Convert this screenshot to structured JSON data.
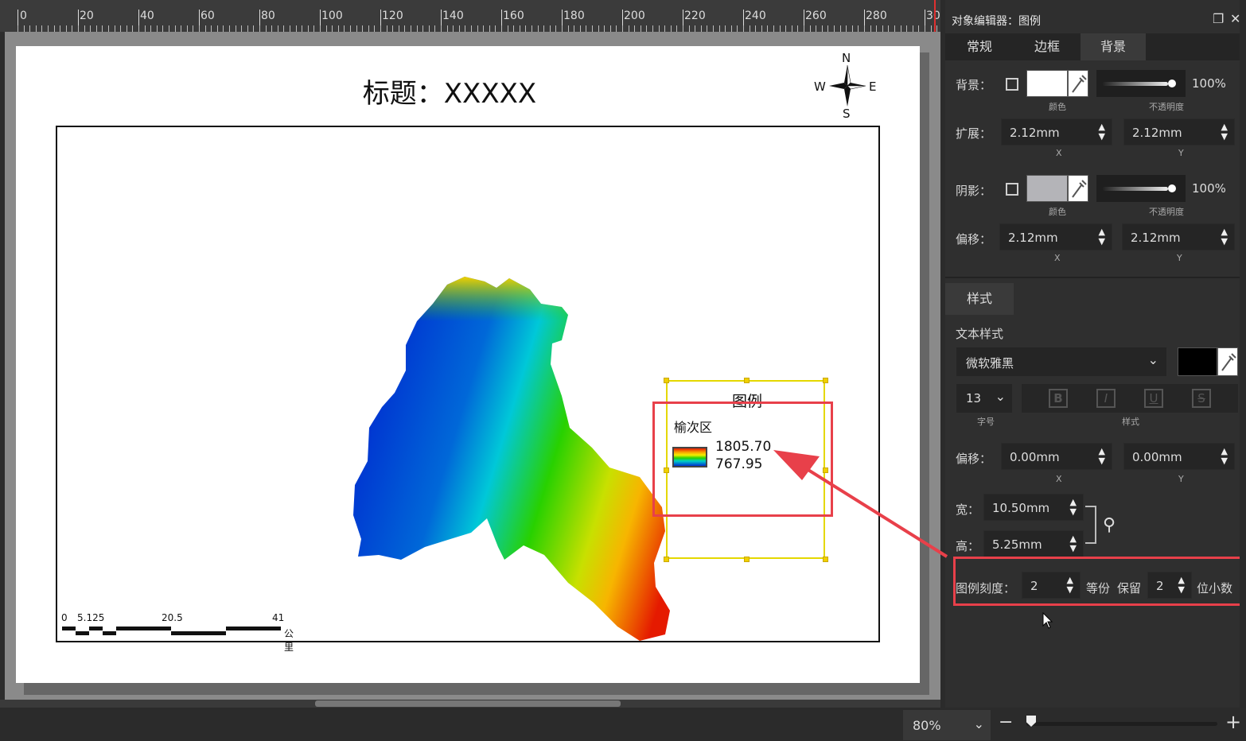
{
  "ruler": {
    "labels": [
      "0",
      "20",
      "40",
      "60",
      "80",
      "100",
      "120",
      "140",
      "160",
      "180",
      "200",
      "220",
      "240",
      "260",
      "280",
      "30"
    ]
  },
  "map": {
    "title": "标题：XXXXX",
    "compass": {
      "n": "N",
      "s": "S",
      "e": "E",
      "w": "W"
    },
    "scalebar": {
      "labels": [
        "0",
        "5.125",
        "20.5",
        "41"
      ],
      "unit": "公里"
    },
    "legend": {
      "title": "图例",
      "layer": "榆次区",
      "max": "1805.70",
      "min": "767.95",
      "colors": [
        "#e51a00",
        "#f7a500",
        "#f3f000",
        "#28d100",
        "#00d0c8",
        "#0030d0"
      ]
    },
    "dem_colors": {
      "low": "#0030d0",
      "mid_low": "#00c8d8",
      "mid": "#28d100",
      "mid_high": "#f3f000",
      "high": "#e51a00"
    }
  },
  "panel": {
    "title": "对象编辑器：图例",
    "icons": {
      "restore": "restore-icon",
      "close": "close-icon"
    },
    "tabs": [
      "常规",
      "边框",
      "背景"
    ],
    "active_tab": "背景",
    "background": {
      "label": "背景：",
      "color_caption": "颜色",
      "opacity": "100%",
      "opacity_caption": "不透明度",
      "color": "#ffffff"
    },
    "extend": {
      "label": "扩展：",
      "x": "2.12mm",
      "y": "2.12mm",
      "x_caption": "X",
      "y_caption": "Y"
    },
    "shadow": {
      "label": "阴影：",
      "color_caption": "颜色",
      "opacity": "100%",
      "opacity_caption": "不透明度",
      "color": "#b4b4b8"
    },
    "offset": {
      "label": "偏移：",
      "x": "2.12mm",
      "y": "2.12mm",
      "x_caption": "X",
      "y_caption": "Y"
    },
    "style_tab": "样式",
    "text_style": {
      "label": "文本样式",
      "font": "微软雅黑",
      "font_color": "#000000",
      "size": "13",
      "size_caption": "字号",
      "style_caption": "样式",
      "buttons": [
        "B",
        "I",
        "U",
        "S"
      ]
    },
    "text_offset": {
      "label": "偏移：",
      "x": "0.00mm",
      "y": "0.00mm",
      "x_caption": "X",
      "y_caption": "Y"
    },
    "width": {
      "label": "宽：",
      "value": "10.50mm"
    },
    "height": {
      "label": "高：",
      "value": "5.25mm"
    },
    "divisions": {
      "label": "图例刻度：",
      "value": "2",
      "unit": "等份",
      "keep_label": "保留",
      "decimals": "2",
      "decimals_unit": "位小数"
    }
  },
  "zoom": {
    "value": "80%",
    "minus": "−",
    "plus": "+"
  },
  "accent": "#e8404a",
  "selection_color": "#e5d800"
}
